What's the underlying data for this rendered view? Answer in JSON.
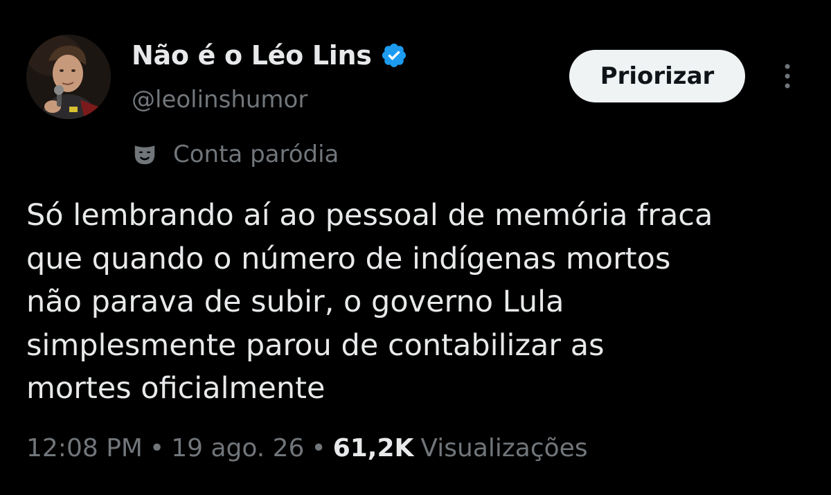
{
  "author": {
    "display_name": "Não é o Léo Lins",
    "handle": "@leolinshumor",
    "verified": true,
    "badge_color": "#1d9bf0",
    "account_label": "Conta paródia",
    "account_label_icon": "mask-icon"
  },
  "actions": {
    "prioritize_label": "Priorizar",
    "more_icon": "more-vertical-icon"
  },
  "tweet": {
    "lines": [
      "Só lembrando aí ao pessoal de memória fraca",
      "que quando o número de indígenas mortos",
      "não parava de subir, o governo Lula",
      "simplesmente parou de contabilizar as",
      "mortes oficialmente"
    ]
  },
  "meta": {
    "time": "12:08 PM",
    "separator": "•",
    "date": "19 ago. 26",
    "views_count": "61,2K",
    "views_label": "Visualizações"
  },
  "colors": {
    "background": "#000000",
    "primary_text": "#e7e9ea",
    "secondary_text": "#71767b",
    "button_bg": "#eff3f4",
    "button_text": "#0f1419"
  }
}
